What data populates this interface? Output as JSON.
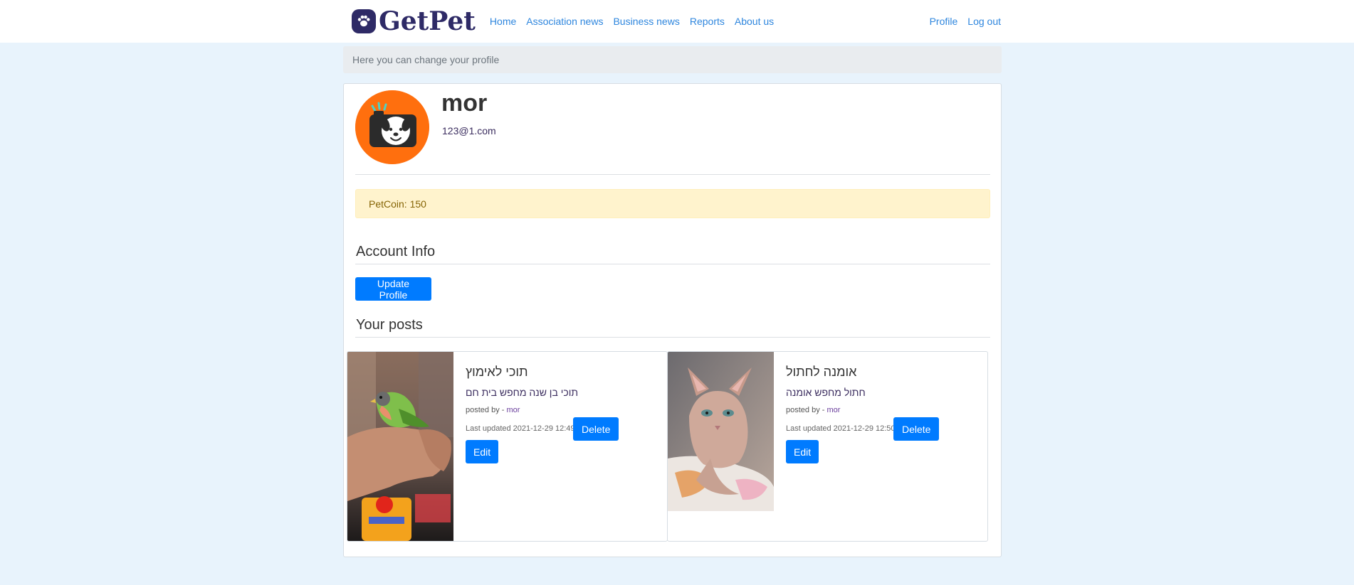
{
  "nav": {
    "brand": "GetPet",
    "links": [
      "Home",
      "Association news",
      "Business news",
      "Reports",
      "About us"
    ],
    "right_links": [
      "Profile",
      "Log out"
    ]
  },
  "breadcrumb": "Here you can change your profile",
  "profile": {
    "name": "mor",
    "email": "123@1.com",
    "petcoin": "PetCoin: 150"
  },
  "account": {
    "title": "Account Info",
    "update_label": "Update Profile"
  },
  "posts": {
    "title": "Your posts",
    "items": [
      {
        "title": "תוכי לאימוץ",
        "description": "תוכי בן שנה מחפש בית חם",
        "posted_by_label": "posted by -",
        "author": "mor",
        "updated": "Last updated 2021-12-29 12:49",
        "delete_label": "Delete",
        "edit_label": "Edit"
      },
      {
        "title": "אומנה לחתול",
        "description": "חתול מחפש אומנה",
        "posted_by_label": "posted by -",
        "author": "mor",
        "updated": "Last updated 2021-12-29 12:50",
        "delete_label": "Delete",
        "edit_label": "Edit"
      }
    ]
  },
  "colors": {
    "brand": "#2e2a66",
    "link": "#2e86de",
    "primary_button": "#007bff",
    "avatar_bg": "#ff6f0e",
    "alert_bg": "#fff3cd",
    "page_bg": "#e8f3fc"
  },
  "icons": {
    "brand_logo": "paw-icon",
    "avatar": "camera-dog-icon"
  }
}
